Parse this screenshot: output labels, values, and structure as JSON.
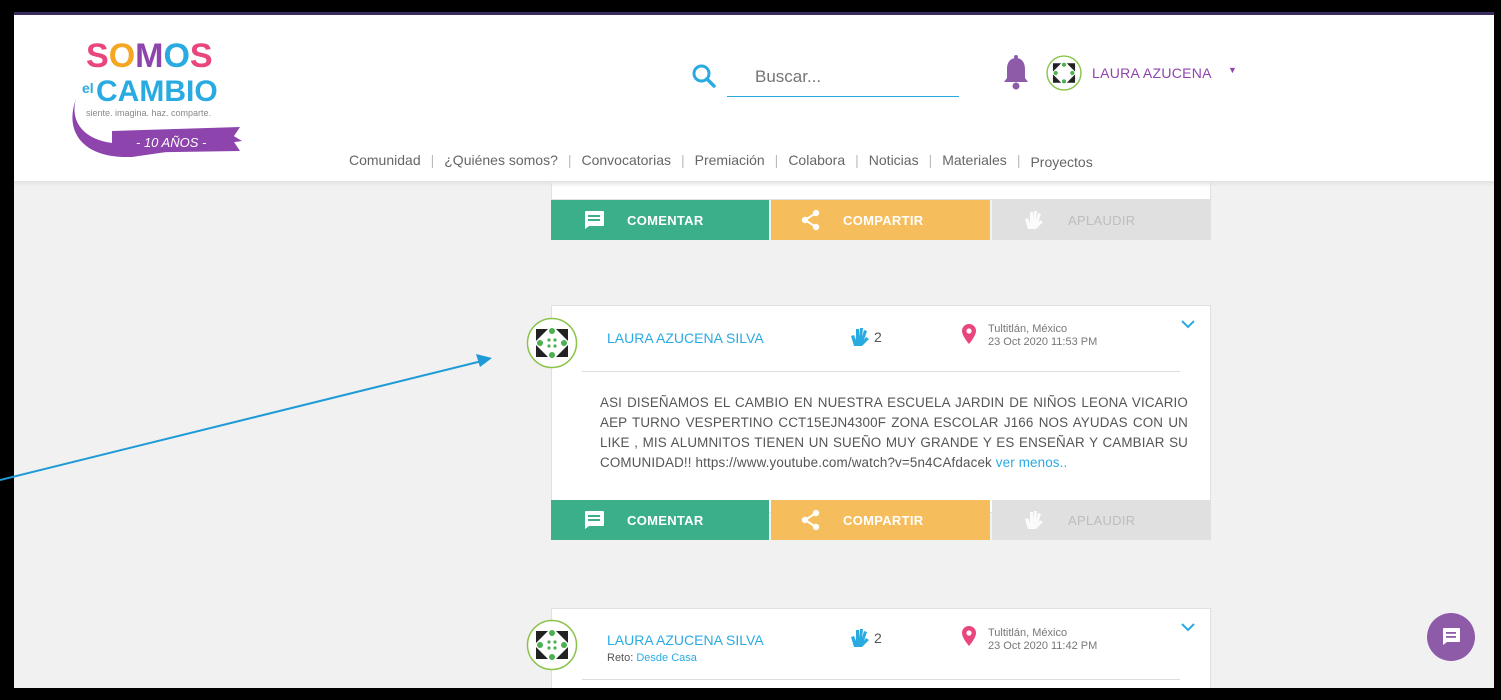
{
  "brand": {
    "logo_line1": "SOMOS",
    "logo_line2_prefix": "el",
    "logo_line2": "CAMBIO",
    "tagline": "siente. imagina. haz. comparte.",
    "anniversary": "- 10 AÑOS -"
  },
  "search": {
    "placeholder": "Buscar..."
  },
  "user": {
    "name": "LAURA AZUCENA"
  },
  "nav": {
    "items": [
      "Comunidad",
      "¿Quiénes somos?",
      "Convocatorias",
      "Premiación",
      "Colabora",
      "Noticias",
      "Materiales",
      "Proyectos"
    ]
  },
  "actions": {
    "comment": "COMENTAR",
    "share": "COMPARTIR",
    "clap": "APLAUDIR"
  },
  "posts": [
    {
      "author": "LAURA AZUCENA SILVA",
      "claps": "2",
      "location": "Tultitlán, México",
      "date": "23 Oct 2020 11:53 PM",
      "body": "ASI DISEÑAMOS EL CAMBIO EN NUESTRA ESCUELA JARDIN DE NIÑOS LEONA VICARIO AEP TURNO VESPERTINO CCT15EJN4300F ZONA ESCOLAR J166 NOS AYUDAS CON UN LIKE , MIS ALUMNITOS TIENEN UN SUEÑO MUY GRANDE Y ES ENSEÑAR Y CAMBIAR SU COMUNIDAD!! https://www.youtube.com/watch?v=5n4CAfdacek",
      "toggle": "ver menos.."
    },
    {
      "author": "LAURA AZUCENA SILVA",
      "challenge_label": "Reto:",
      "challenge": "Desde Casa",
      "claps": "2",
      "location": "Tultitlán, México",
      "date": "23 Oct 2020 11:42 PM"
    }
  ],
  "colors": {
    "accent_blue": "#29abe2",
    "brand_purple": "#8e44ad",
    "comment_green": "#3aaf8a",
    "share_yellow": "#f5bd5b",
    "clap_gray": "#e0e0e0",
    "location_pink": "#e8467c"
  }
}
